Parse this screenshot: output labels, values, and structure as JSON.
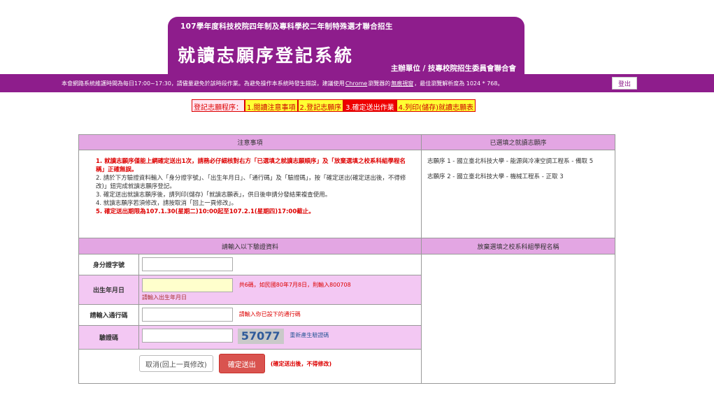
{
  "header": {
    "subtitle": "107學年度科技校院四年制及專科學校二年制特殊選才聯合招生",
    "title": "就讀志願序登記系統",
    "organizer": "主辦單位 / 技專校院招生委員會聯合會"
  },
  "notice": {
    "text_before": "本會網路系統維護時間為每日17:00~17:30，請儘量避免於該時段作業。為避免操作本系統時發生錯誤，建議使用",
    "chrome": "Chrome",
    "text_mid": "瀏覽器的",
    "incognito": "無痕視窗",
    "text_after": "，最佳瀏覽解析度為 1024 * 768。",
    "logout_label": "登出"
  },
  "steps": {
    "label": "登記志願程序：",
    "s1": "1.閱讀注意事項",
    "s2": "2.登記志願序",
    "s3": "3.確定送出作業",
    "s4": "4.列印(儲存)就讀志願表"
  },
  "notes": {
    "heading": "注意事項",
    "items": [
      "1. 就讀志願序僅能上網確定送出1次，請務必仔細核對右方「已選填之就讀志願順序」及「放棄選填之校系科組學程名稱」正確無誤。",
      "2. 請於下方驗證資料輸入「身分證字號」、「出生年月日」、「通行碼」及「驗證碼」，按「確定送出(確定送出後，不得修改)」鈕完成就讀志願序登記。",
      "3. 確定送出就讀志願序後，請列印(儲存)「就讀志願表」，供日後申請分發結果複查使用。",
      "4. 就讀志願序若須修改，請按取消「回上一頁修改」。",
      "5. 確定送出期限為107.1.30(星期二)10:00起至107.2.1(星期四)17:00截止。"
    ]
  },
  "chosen": {
    "heading": "已選填之就讀志願序",
    "items": [
      "志願序 1 - 國立臺北科技大學 - 能源與冷凍空調工程系 - 備取 5",
      "志願序 2 - 國立臺北科技大學 - 機械工程系 - 正取 3"
    ]
  },
  "form": {
    "heading": "請輸入以下驗證資料",
    "id_label": "身分證字號",
    "id_value": "",
    "birth_label": "出生年月日",
    "birth_value": "",
    "birth_hint": "共6碼，如民國80年7月8日，則輸入800708",
    "birth_hint2": "請輸入出生年月日",
    "pass_label": "請輸入通行碼",
    "pass_value": "",
    "pass_hint": "請輸入你已設下的通行碼",
    "captcha_label": "驗證碼",
    "captcha_value": "",
    "captcha_code": "57077",
    "captcha_refresh": "重新產生驗證碼"
  },
  "buttons": {
    "cancel": "取消(回上一頁修改)",
    "confirm": "確定送出",
    "confirm_warning": "(確定送出後，不得修改)"
  },
  "abandoned": {
    "heading": "放棄選填之校系科組學程名稱"
  }
}
